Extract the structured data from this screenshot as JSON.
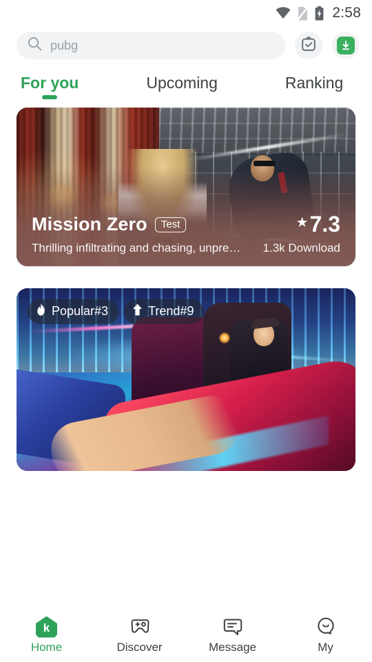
{
  "status_bar": {
    "time": "2:58",
    "icons": [
      "wifi-icon",
      "no-sim-icon",
      "battery-charging-icon"
    ]
  },
  "search": {
    "value": "pubg",
    "placeholder": "pubg",
    "icon": "search-icon",
    "actions": [
      {
        "name": "tasks-clipboard-icon",
        "label": "Tasks"
      },
      {
        "name": "downloads-icon",
        "label": "Downloads"
      }
    ]
  },
  "tabs": [
    {
      "label": "For you",
      "active": true
    },
    {
      "label": "Upcoming",
      "active": false
    },
    {
      "label": "Ranking",
      "active": false
    }
  ],
  "cards": [
    {
      "title": "Mission Zero",
      "tag": "Test",
      "description": "Thrilling infiltrating and chasing, unpre…",
      "rating": "7.3",
      "rating_icon": "star-icon",
      "downloads": "1.3k Download"
    },
    {
      "badges": [
        {
          "icon": "fire-icon",
          "label": "Popular#3"
        },
        {
          "icon": "arrow-up-icon",
          "label": "Trend#9"
        }
      ]
    }
  ],
  "bottom_nav": [
    {
      "label": "Home",
      "icon": "home-k-icon",
      "active": true
    },
    {
      "label": "Discover",
      "icon": "gamepad-icon",
      "active": false
    },
    {
      "label": "Message",
      "icon": "chat-bubble-icon",
      "active": false
    },
    {
      "label": "My",
      "icon": "profile-face-icon",
      "active": false
    }
  ],
  "colors": {
    "accent": "#2fa25a",
    "download_green": "#3ab05f",
    "text_primary": "#3c4043",
    "text_muted": "#9aa0a6",
    "field_bg": "#f1f3f4"
  }
}
